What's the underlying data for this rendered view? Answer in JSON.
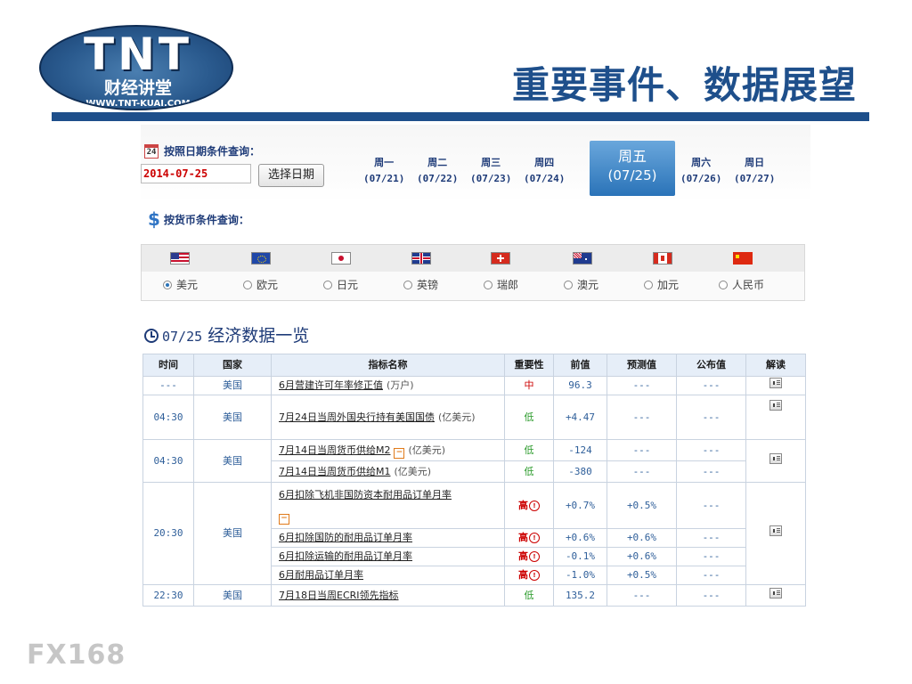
{
  "logo": {
    "brand": "TNT",
    "name_cn": "财经讲堂",
    "url": "WWW.TNT-KUAI.COM"
  },
  "headline": "重要事件、数据展望",
  "date_query": {
    "label": "按照日期条件查询：",
    "calendar_day": "24",
    "date_value": "2014-07-25",
    "pick_button": "选择日期",
    "days": [
      {
        "weekday": "周一",
        "date": "(07/21)"
      },
      {
        "weekday": "周二",
        "date": "(07/22)"
      },
      {
        "weekday": "周三",
        "date": "(07/23)"
      },
      {
        "weekday": "周四",
        "date": "(07/24)"
      },
      {
        "weekday": "周五",
        "date": "(07/25)"
      },
      {
        "weekday": "周六",
        "date": "(07/26)"
      },
      {
        "weekday": "周日",
        "date": "(07/27)"
      }
    ],
    "active_day": "周五"
  },
  "currency_query": {
    "icon": "$",
    "label": "按货币条件查询：",
    "currencies": [
      "美元",
      "欧元",
      "日元",
      "英镑",
      "瑞郎",
      "澳元",
      "加元",
      "人民币"
    ],
    "selected": "美元"
  },
  "table_title": {
    "date": "07/25",
    "text": "经济数据一览"
  },
  "table": {
    "headers": [
      "时间",
      "国家",
      "指标名称",
      "重要性",
      "前值",
      "预测值",
      "公布值",
      "解读"
    ],
    "rows": [
      {
        "time": "---",
        "country": "美国",
        "name": "6月营建许可年率修正值",
        "unit": "(万户)",
        "importance": "中",
        "prev": "96.3",
        "forecast": "---",
        "actual": "---"
      },
      {
        "time": "04:30",
        "country": "美国",
        "name": "7月24日当周外国央行持有美国国债",
        "unit": "(亿美元)",
        "importance": "低",
        "prev": "+4.47",
        "forecast": "---",
        "actual": "---"
      },
      {
        "time": "04:30",
        "country": "美国",
        "name": "7月14日当周货币供给M2",
        "unit": "(亿美元)",
        "importance": "低",
        "prev": "-124",
        "forecast": "---",
        "actual": "---"
      },
      {
        "name": "7月14日当周货币供给M1",
        "unit": "(亿美元)",
        "importance": "低",
        "prev": "-380",
        "forecast": "---",
        "actual": "---"
      },
      {
        "time": "20:30",
        "country": "美国",
        "name": "6月扣除飞机非国防资本耐用品订单月率",
        "importance": "高",
        "prev": "+0.7%",
        "forecast": "+0.5%",
        "actual": "---"
      },
      {
        "name": "6月扣除国防的耐用品订单月率",
        "importance": "高",
        "prev": "+0.6%",
        "forecast": "+0.6%",
        "actual": "---"
      },
      {
        "name": "6月扣除运输的耐用品订单月率",
        "importance": "高",
        "prev": "-0.1%",
        "forecast": "+0.6%",
        "actual": "---"
      },
      {
        "name": "6月耐用品订单月率",
        "importance": "高",
        "prev": "-1.0%",
        "forecast": "+0.5%",
        "actual": "---"
      },
      {
        "time": "22:30",
        "country": "美国",
        "name": "7月18日当周ECRI领先指标",
        "importance": "低",
        "prev": "135.2",
        "forecast": "---",
        "actual": "---"
      }
    ]
  },
  "footer_logo": "FX168",
  "colors": {
    "brand_blue": "#1e4f8b",
    "active_day": "#2a73b8",
    "high": "#cc0000",
    "low": "#2a9a2a"
  }
}
